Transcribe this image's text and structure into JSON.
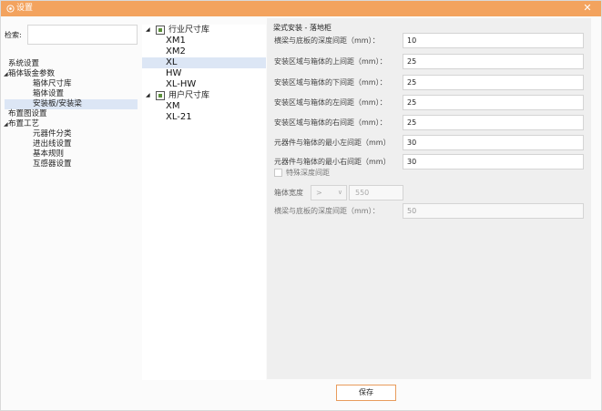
{
  "window": {
    "title": "设置",
    "close_glyph": "✕",
    "title_icon": "settings-icon",
    "accent_color": "#f3a35e"
  },
  "search": {
    "label": "检索:",
    "value": ""
  },
  "nav": {
    "items": [
      {
        "label": "系统设置",
        "level": 0,
        "expanded": false,
        "selected": false
      },
      {
        "label": "箱体钣金参数",
        "level": 0,
        "expanded": true,
        "selected": false
      },
      {
        "label": "箱体尺寸库",
        "level": 1,
        "selected": false
      },
      {
        "label": "箱体设置",
        "level": 1,
        "selected": false
      },
      {
        "label": "安装板/安装梁",
        "level": 1,
        "selected": true
      },
      {
        "label": "布置图设置",
        "level": 0,
        "expanded": false,
        "selected": false
      },
      {
        "label": "布置工艺",
        "level": 0,
        "expanded": true,
        "selected": false
      },
      {
        "label": "元器件分类",
        "level": 1,
        "selected": false
      },
      {
        "label": "进出线设置",
        "level": 1,
        "selected": false
      },
      {
        "label": "基本规则",
        "level": 1,
        "selected": false
      },
      {
        "label": "互感器设置",
        "level": 1,
        "selected": false
      }
    ]
  },
  "library": {
    "industry": {
      "label": "行业尺寸库",
      "items": [
        {
          "label": "XM1",
          "selected": false
        },
        {
          "label": "XM2",
          "selected": false
        },
        {
          "label": "XL",
          "selected": true
        },
        {
          "label": "HW",
          "selected": false
        },
        {
          "label": "XL-HW",
          "selected": false
        }
      ]
    },
    "user": {
      "label": "用户尺寸库",
      "items": [
        {
          "label": "XM",
          "selected": false
        },
        {
          "label": "XL-21",
          "selected": false
        }
      ]
    }
  },
  "form": {
    "section_title": "梁式安装 - 落地柜",
    "rows": [
      {
        "label": "横梁与底板的深度间距（mm）：",
        "value": "10"
      },
      {
        "label": "安装区域与箱体的上间距（mm）：",
        "value": "25"
      },
      {
        "label": "安装区域与箱体的下间距（mm）：",
        "value": "25"
      },
      {
        "label": "安装区域与箱体的左间距（mm）：",
        "value": "25"
      },
      {
        "label": "安装区域与箱体的右间距（mm）：",
        "value": "25"
      },
      {
        "label": "元器件与箱体的最小左间距（mm）",
        "value": "30"
      },
      {
        "label": "元器件与箱体的最小右间距（mm）",
        "value": "30"
      }
    ],
    "special_depth": {
      "label": "特殊深度间距",
      "checked": false
    },
    "box_width": {
      "label": "箱体宽度",
      "operator": ">",
      "chevron": "∨",
      "value": "550"
    },
    "special_row": {
      "label": "横梁与底板的深度间距（mm）：",
      "value": "50"
    }
  },
  "footer": {
    "save_label": "保存"
  }
}
